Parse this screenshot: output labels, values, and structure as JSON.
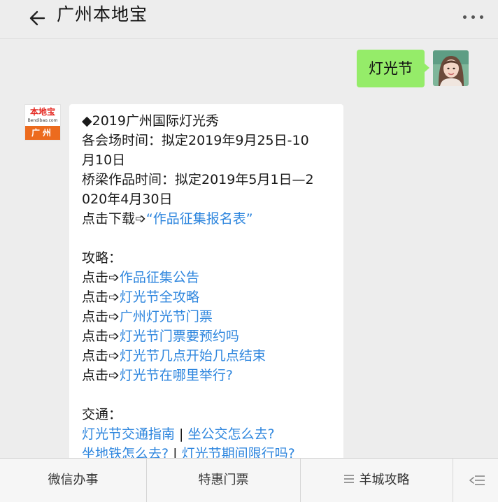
{
  "header": {
    "title": "广州本地宝",
    "back_icon": "arrow-left-icon",
    "more_icon": "more-dots-icon"
  },
  "outgoing": {
    "text": "灯光节"
  },
  "bot": {
    "logo_text": "本地宝",
    "logo_sub": "Bendibao.com",
    "logo_city": "广州"
  },
  "incoming": {
    "l1": "◆2019广州国际灯光秀",
    "l2": "各会场时间：拟定2019年9月25日-10",
    "l3": "月10日",
    "l4": "桥梁作品时间：拟定2019年5月1日—2",
    "l5": "020年4月30日",
    "l6_prefix": "点击下载➩",
    "l6_link": "“作品征集报名表”",
    "guide_label": "攻略：",
    "click_prefix": "点击➩",
    "guide_links": [
      "作品征集公告",
      "灯光节全攻略",
      "广州灯光节门票",
      "灯光节门票要预约吗",
      "灯光节几点开始几点结束",
      "灯光节在哪里举行?"
    ],
    "traffic_label": "交通：",
    "traffic_link1": "灯光节交通指南",
    "traffic_sep": " | ",
    "traffic_link2": "坐公交怎么去?",
    "traffic_link3": "坐地铁怎么去?",
    "traffic_link4": "灯光节期间限行吗?"
  },
  "menu": {
    "item1": "微信办事",
    "item2": "特惠门票",
    "item3": "羊城攻略",
    "item3_icon": "list-icon",
    "keyboard_icon": "keyboard-toggle-icon"
  },
  "colors": {
    "out_bubble": "#95ec69",
    "link": "#2e86de",
    "background": "#ededed"
  }
}
